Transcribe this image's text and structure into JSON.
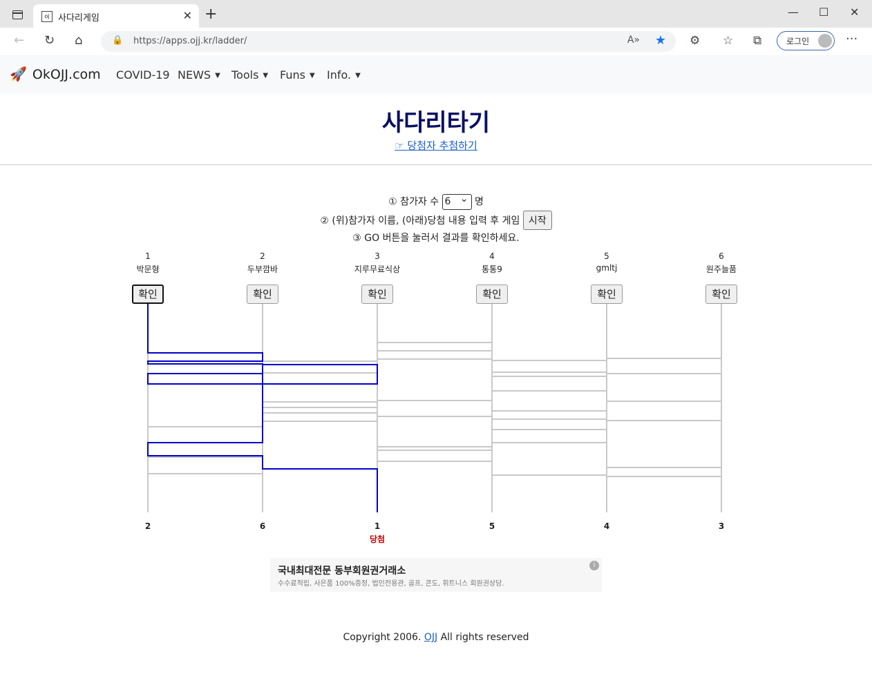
{
  "browser": {
    "tab_title": "사다리게임",
    "url": "https://apps.ojj.kr/ladder/",
    "login_label": "로그인"
  },
  "nav": {
    "brand": "OkOJJ.com",
    "links": [
      "COVID-19",
      "NEWS",
      "Tools",
      "Funs",
      "Info."
    ]
  },
  "page": {
    "title": "사다리타기",
    "sublink": "☞ 당첨자 추첨하기",
    "step1_a": "① 참가자 수",
    "step1_value": "6",
    "step1_b": "명",
    "step2": "② (위)참가자 이름, (아래)당첨 내용 입력 후 게임",
    "start_label": "시작",
    "step3": "③ GO 버튼을 눌러서 결과를 확인하세요."
  },
  "ladder": {
    "participants": [
      {
        "num": "1",
        "name": "박문형"
      },
      {
        "num": "2",
        "name": "두부깜바"
      },
      {
        "num": "3",
        "name": "지루무료식상"
      },
      {
        "num": "4",
        "name": "통통9"
      },
      {
        "num": "5",
        "name": "gmltj"
      },
      {
        "num": "6",
        "name": "원주늘품"
      }
    ],
    "check_label": "확인",
    "results": [
      "2",
      "6",
      "1",
      "5",
      "4",
      "3"
    ],
    "winner_label": "당첨",
    "path_color": "#0000c8",
    "line_color": "#c8c8c8"
  },
  "ad": {
    "title": "국내최대전문 동부회원권거래소",
    "desc": "수수료적립, 사은품 100%증정, 법인전용관, 골프, 콘도, 휘트니스 회원권상담."
  },
  "footer": {
    "pre": "Copyright 2006.",
    "link": "OJJ",
    "post": "All rights reserved"
  }
}
